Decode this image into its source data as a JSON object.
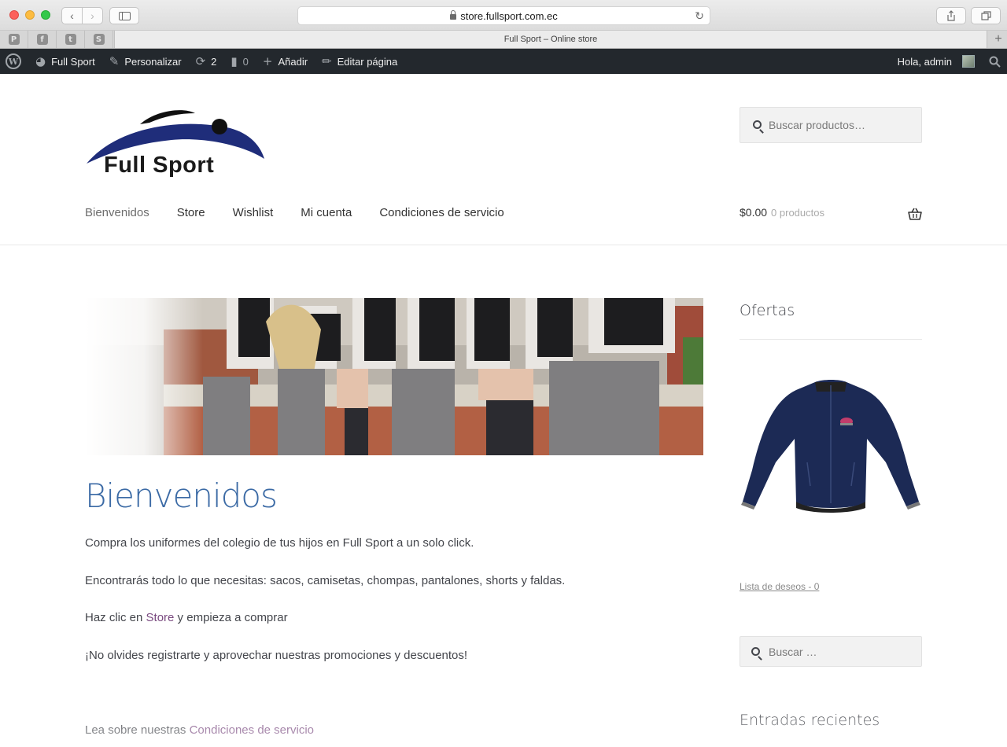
{
  "browser": {
    "url": "store.fullsport.com.ec",
    "pinned_tabs": [
      "P",
      "f",
      "t",
      "S"
    ],
    "active_tab_title": "Full Sport – Online store"
  },
  "adminbar": {
    "site_name": "Full Sport",
    "customize": "Personalizar",
    "updates_count": "2",
    "comments_count": "0",
    "add_new": "Añadir",
    "edit_page": "Editar página",
    "greeting": "Hola, admin"
  },
  "header": {
    "logo_text": "Full Sport",
    "search_placeholder": "Buscar productos…",
    "nav": [
      "Bienvenidos",
      "Store",
      "Wishlist",
      "Mi cuenta",
      "Condiciones de servicio"
    ],
    "cart_amount": "$0.00",
    "cart_count": "0 productos"
  },
  "content": {
    "title": "Bienvenidos",
    "p1": "Compra los uniformes del colegio de tus hijos en Full Sport a un solo click.",
    "p2": "Encontrarás todo lo que necesitas: sacos, camisetas, chompas, pantalones, shorts y faldas.",
    "p3_before": "Haz clic en ",
    "p3_link": "Store",
    "p3_after": " y empieza a comprar",
    "p4": "¡No olvides registrarte y aprovechar nuestras promociones y descuentos!",
    "p5_before": "Lea sobre nuestras ",
    "p5_link": "Condiciones de servicio"
  },
  "sidebar": {
    "offers_title": "Ofertas",
    "wishlist_link": "Lista de deseos - 0",
    "search_placeholder": "Buscar …",
    "recent_title": "Entradas recientes"
  },
  "colors": {
    "adminbar_bg": "#23282d",
    "title_blue": "#3b6aa5",
    "link_purple": "#7a4a80",
    "logo_navy": "#1f2d7a"
  }
}
